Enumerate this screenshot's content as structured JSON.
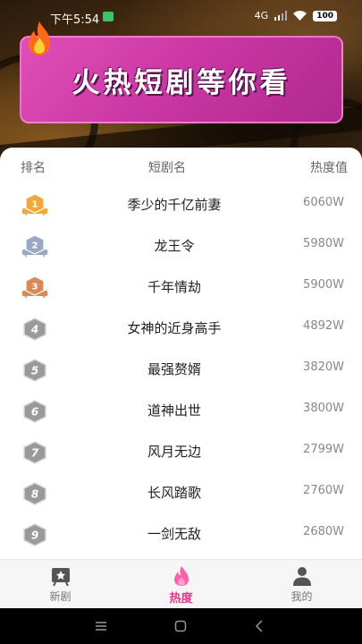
{
  "status_bar": {
    "time": "下午5:54",
    "network": "4G",
    "battery": "100"
  },
  "banner": {
    "title": "火热短剧等你看"
  },
  "table": {
    "headers": {
      "rank": "排名",
      "name": "短剧名",
      "heat": "热度值"
    },
    "rows": [
      {
        "rank": "1",
        "name": "季少的千亿前妻",
        "heat": "6060W"
      },
      {
        "rank": "2",
        "name": "龙王令",
        "heat": "5980W"
      },
      {
        "rank": "3",
        "name": "千年情劫",
        "heat": "5900W"
      },
      {
        "rank": "4",
        "name": "女神的近身高手",
        "heat": "4892W"
      },
      {
        "rank": "5",
        "name": "最强赘婿",
        "heat": "3820W"
      },
      {
        "rank": "6",
        "name": "道神出世",
        "heat": "3800W"
      },
      {
        "rank": "7",
        "name": "风月无边",
        "heat": "2799W"
      },
      {
        "rank": "8",
        "name": "长风踏歌",
        "heat": "2760W"
      },
      {
        "rank": "9",
        "name": "一剑无敌",
        "heat": "2680W"
      }
    ]
  },
  "tabbar": {
    "tabs": [
      {
        "label": "新剧",
        "icon": "star-board-icon"
      },
      {
        "label": "热度",
        "icon": "flame-icon",
        "active": true
      },
      {
        "label": "我的",
        "icon": "user-icon"
      }
    ]
  },
  "colors": {
    "accent": "#e0368a",
    "banner": "#d444ad",
    "gold": "#f0a93c",
    "silver": "#9aa8c2",
    "bronze": "#d98a58",
    "gray_badge": "#9a9a9a"
  }
}
